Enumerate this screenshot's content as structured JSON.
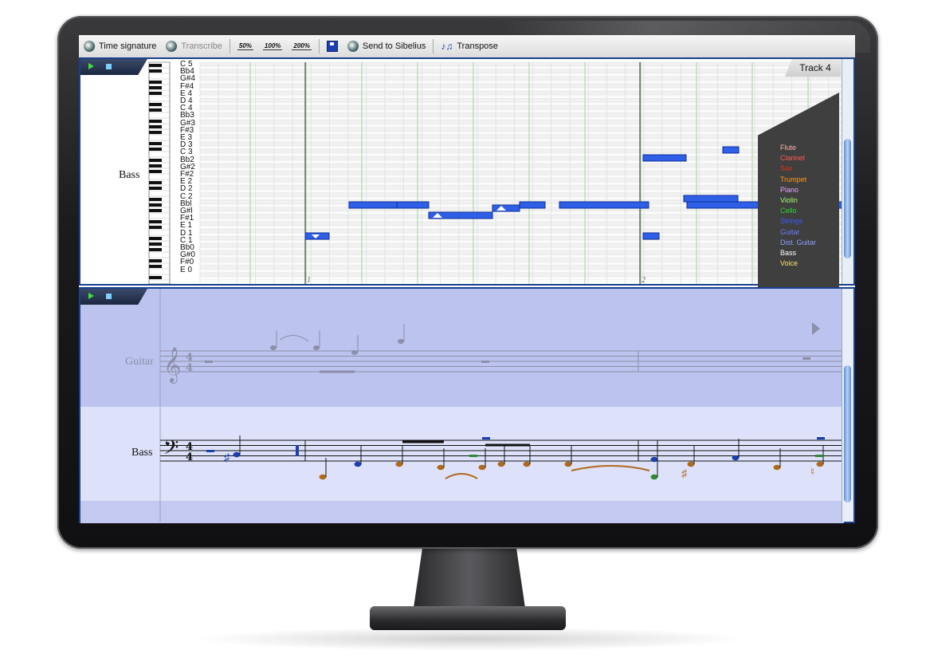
{
  "toolbar": {
    "time_signature": "Time signature",
    "transcribe": "Transcribe",
    "zoom_50": "50%",
    "zoom_100": "100%",
    "zoom_200": "200%",
    "send_to_sibelius": "Send to Sibelius",
    "transpose": "Transpose"
  },
  "piano_roll": {
    "track_tab": "Track 4",
    "instrument": "Bass",
    "note_names": [
      "C 5",
      "Bb4",
      "G#4",
      "F#4",
      "E 4",
      "D 4",
      "C 4",
      "Bb3",
      "G#3",
      "F#3",
      "E 3",
      "D 3",
      "C 3",
      "Bb2",
      "G#2",
      "F#2",
      "E 2",
      "D 2",
      "C 2",
      "Bbl",
      "G#l",
      "F#1",
      "E 1",
      "D 1",
      "C 1",
      "Bb0",
      "G#0",
      "F#0",
      "E 0"
    ],
    "bar_numbers": [
      "1",
      "2"
    ]
  },
  "instrument_list": [
    {
      "name": "Flute",
      "color": "#ffb0b0"
    },
    {
      "name": "Clarinet",
      "color": "#ff5a5a"
    },
    {
      "name": "Sax",
      "color": "#e0301a"
    },
    {
      "name": "Trumpet",
      "color": "#ff9a1a"
    },
    {
      "name": "Piano",
      "color": "#e6a6ff"
    },
    {
      "name": "Violin",
      "color": "#a8ff6a"
    },
    {
      "name": "Cello",
      "color": "#2fd62f"
    },
    {
      "name": "Strings",
      "color": "#3a5cff"
    },
    {
      "name": "Guitar",
      "color": "#6a7cff"
    },
    {
      "name": "Dist. Guitar",
      "color": "#8aa0ff"
    },
    {
      "name": "Bass",
      "color": "#ffffff"
    },
    {
      "name": "Voice",
      "color": "#ffe36a"
    }
  ],
  "score": {
    "guitar_label": "Guitar",
    "bass_label": "Bass",
    "time_sig_top": "4",
    "time_sig_bottom": "4"
  },
  "colors": {
    "note_fill": "#2f5fe6",
    "panel_border": "#1a3f8f",
    "score_bg": "#c3c9f0"
  }
}
